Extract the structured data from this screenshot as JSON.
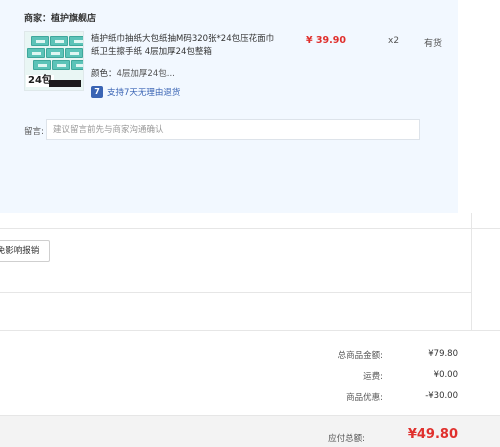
{
  "shop": {
    "label": "商家：",
    "name": "植护旗舰店"
  },
  "product": {
    "image_badge": "24包",
    "title": "植护纸巾抽纸大包纸抽M码320张*24包压花面巾纸卫生擦手纸 4层加厚24包整箱",
    "spec_label": "颜色：",
    "spec_value": "4层加厚24包...",
    "promise_icon": "7",
    "promise_text": "支持7天无理由退货",
    "price": "¥ 39.90",
    "quantity": "x2",
    "stock": "有货"
  },
  "remark": {
    "label": "留言:",
    "placeholder": "建议留言前先与商家沟通确认"
  },
  "insurance_button": "免影响报销",
  "summary": {
    "goods_total_label": "总商品金额:",
    "goods_total_value": "¥79.80",
    "shipping_label": "运费:",
    "shipping_value": "¥0.00",
    "discount_label": "商品优惠:",
    "discount_value": "-¥30.00"
  },
  "total": {
    "label": "应付总额:",
    "value": "¥49.80"
  },
  "colors": {
    "panel_bg": "#f2f8ff",
    "price_red": "#e0302d",
    "link_blue": "#3a64b4"
  }
}
